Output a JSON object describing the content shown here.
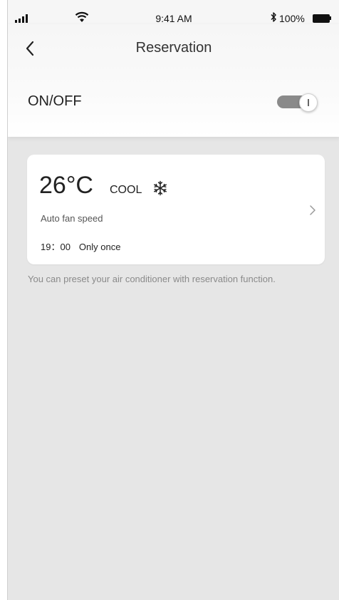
{
  "status_bar": {
    "time": "9:41 AM",
    "battery_percent": "100%"
  },
  "header": {
    "title": "Reservation",
    "back_icon": "chevron-left-icon"
  },
  "power": {
    "label": "ON/OFF",
    "toggle_on": true
  },
  "reservation": {
    "temperature": "26°C",
    "mode": "COOL",
    "mode_icon": "snowflake-icon",
    "fan_speed": "Auto fan speed",
    "time": "19：00",
    "repeat": "Only once"
  },
  "hint": "You can preset your air conditioner with reservation function.",
  "colors": {
    "background": "#e6e6e6",
    "card": "#ffffff",
    "toggle_track": "#8a8a8a",
    "hint_text": "#8a8a8a"
  }
}
